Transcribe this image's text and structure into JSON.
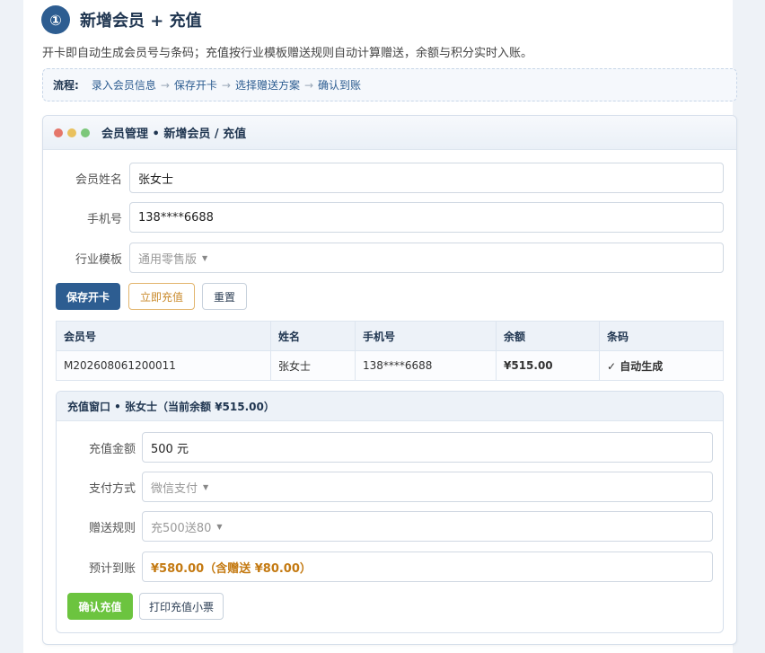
{
  "section": {
    "step": "①",
    "title": "新增会员 + 充值",
    "description": "开卡即自动生成会员号与条码；充值按行业模板赠送规则自动计算赠送，余额与积分实时入账。"
  },
  "flow": {
    "label": "流程:",
    "steps": [
      "录入会员信息",
      "保存开卡",
      "选择赠送方案",
      "确认到账"
    ],
    "arrow": "→"
  },
  "window": {
    "title": "会员管理 • 新增会员 / 充值"
  },
  "member_form": {
    "name_label": "会员姓名",
    "name_value": "张女士",
    "phone_label": "手机号",
    "phone_value": "138****6688",
    "template_label": "行业模板",
    "template_value": "通用零售版"
  },
  "buttons": {
    "save": "保存开卡",
    "recharge_now": "立即充值",
    "reset": "重置",
    "confirm_recharge": "确认充值",
    "print_receipt": "打印充值小票"
  },
  "member_table": {
    "headers": [
      "会员号",
      "姓名",
      "手机号",
      "余额",
      "条码"
    ],
    "rows": [
      [
        "M202608061200011",
        "张女士",
        "138****6688",
        "¥515.00",
        "✓ 自动生成"
      ]
    ]
  },
  "recharge": {
    "title": "充值窗口 • 张女士（当前余额 ¥515.00）",
    "amount_label": "充值金额",
    "amount_value": "500 元",
    "pay_label": "支付方式",
    "pay_value": "微信支付",
    "bonus_label": "赠送规则",
    "bonus_value": "充500送80",
    "expected_label": "预计到账",
    "expected_value": "¥580.00（含赠送 ¥80.00）"
  },
  "colors": {
    "primary": "#2d5d91",
    "success": "#6cc43f",
    "warning": "#c47a12"
  }
}
